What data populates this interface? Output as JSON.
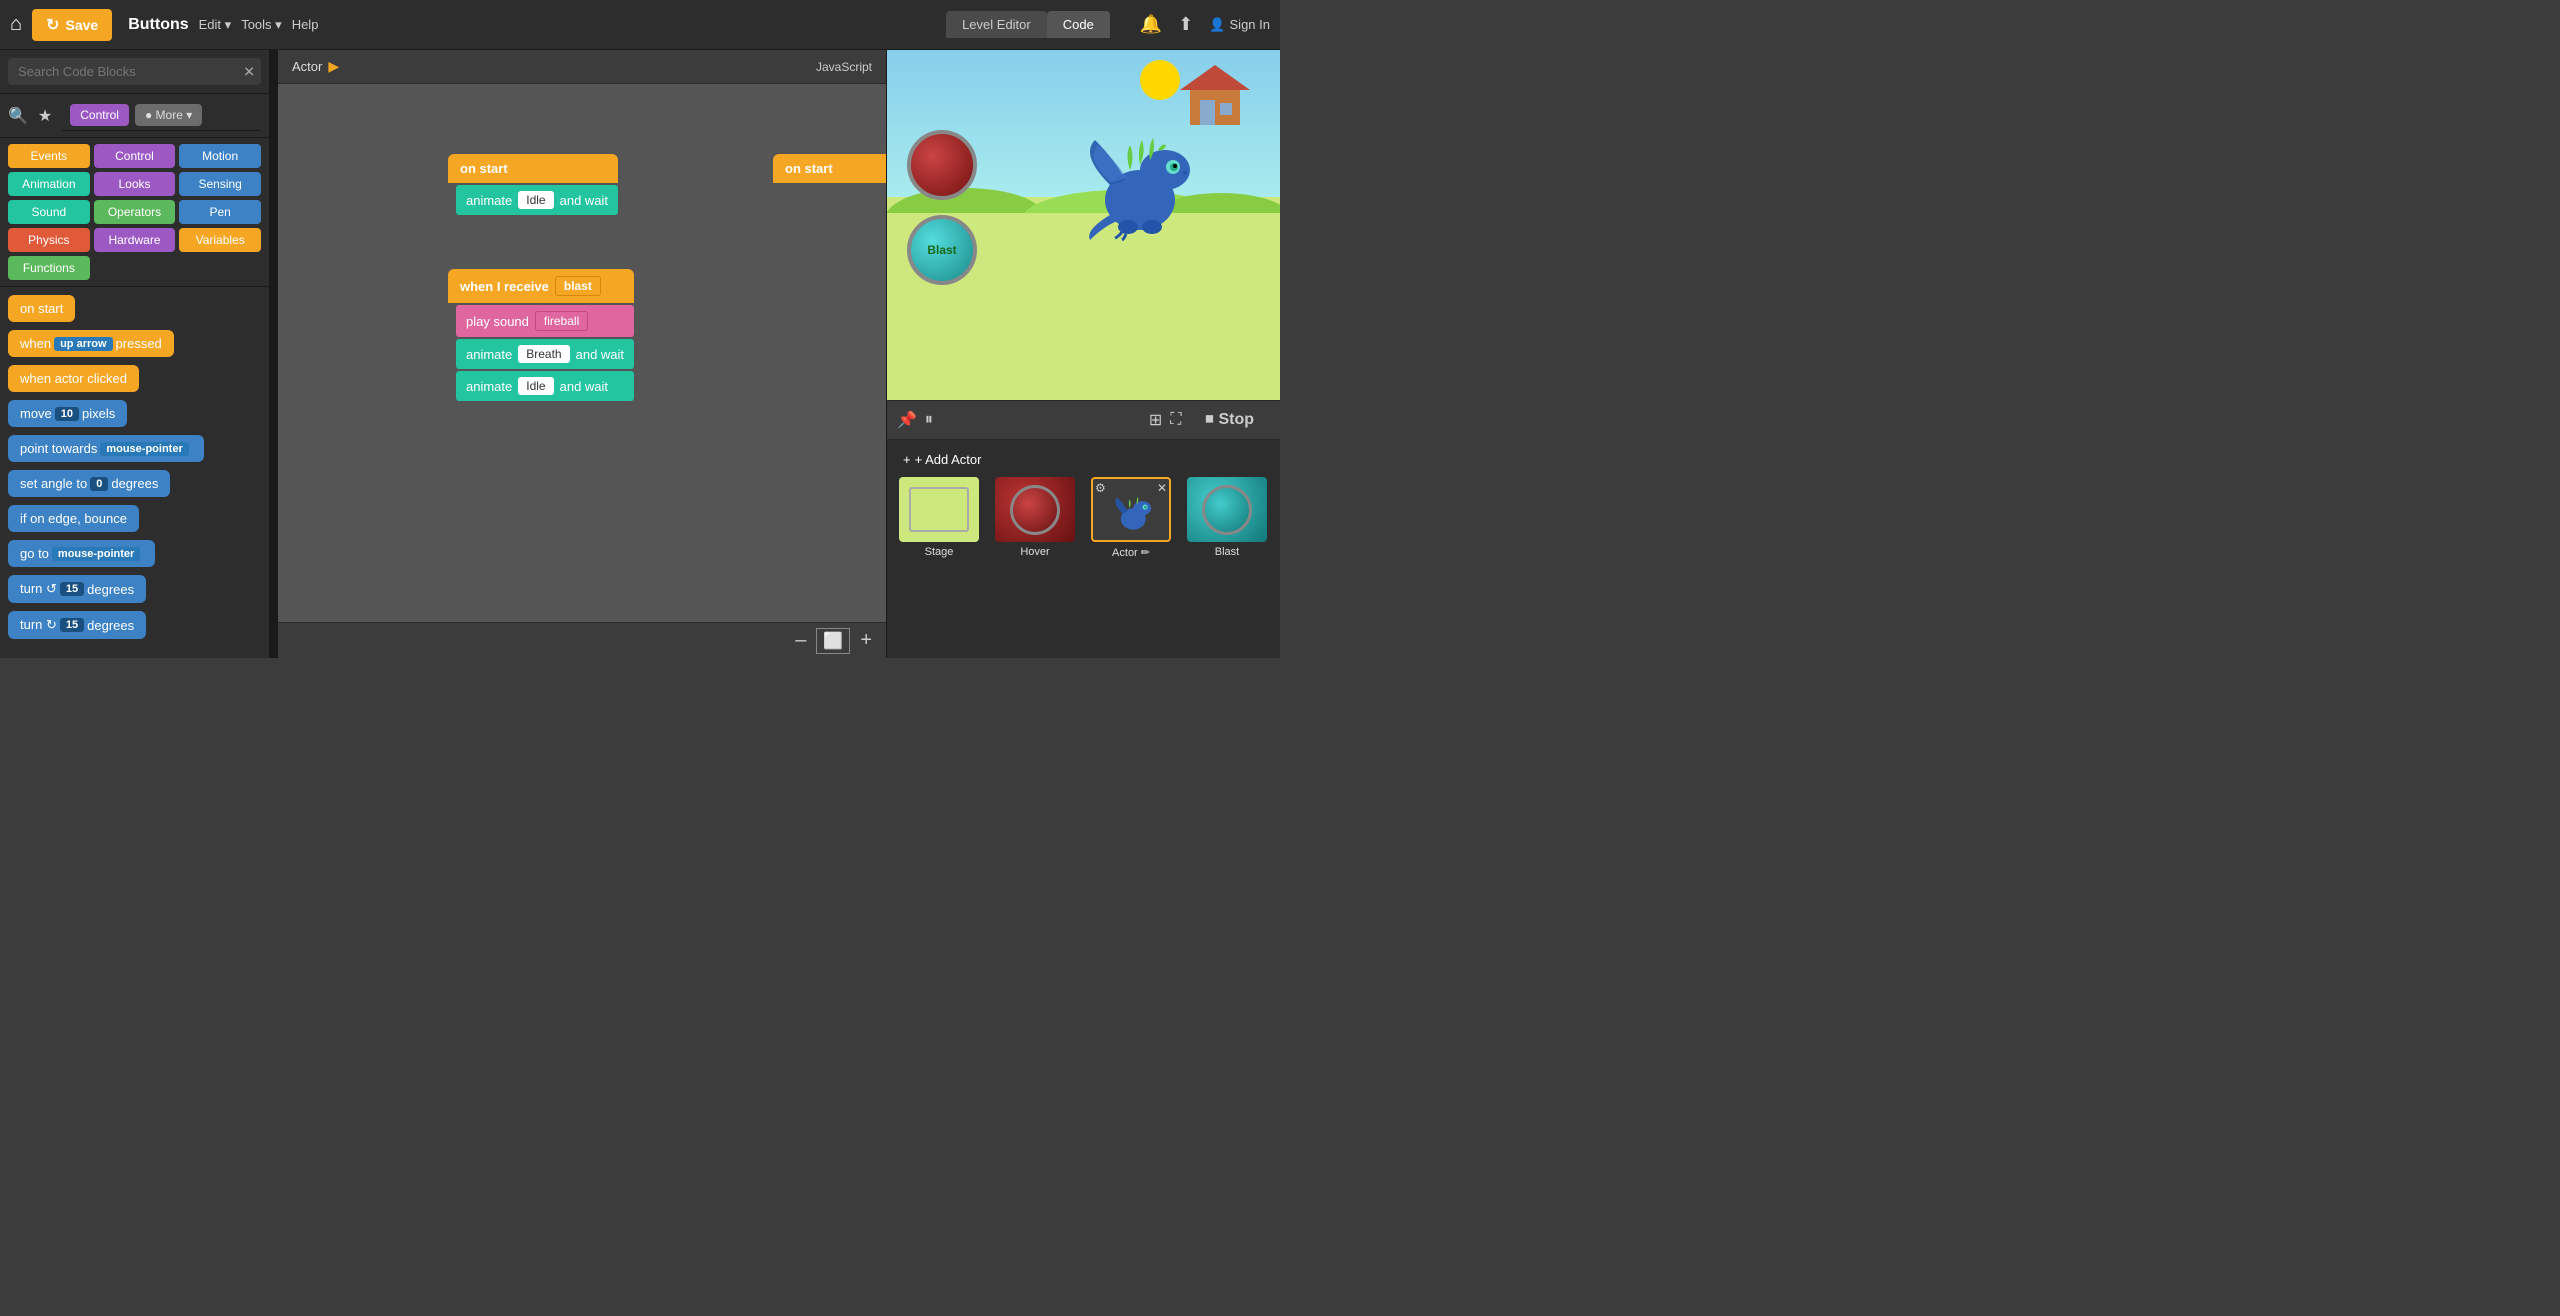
{
  "topbar": {
    "home_label": "⌂",
    "save_label": "Save",
    "app_title": "Buttons",
    "menu": {
      "edit": "Edit ▾",
      "tools": "Tools ▾",
      "help": "Help"
    },
    "tabs": {
      "level_editor": "Level Editor",
      "code": "Code"
    },
    "right": {
      "bell_icon": "🔔",
      "share_icon": "↑",
      "sign_in": "Sign In"
    }
  },
  "left_panel": {
    "search_placeholder": "Search Code Blocks",
    "search_clear": "✕",
    "search_icon": "🔍",
    "star_icon": "★",
    "control_tab": "Control",
    "more_tab": "● More",
    "categories": [
      {
        "label": "Events",
        "class": "cat-events"
      },
      {
        "label": "Control",
        "class": "cat-control"
      },
      {
        "label": "Motion",
        "class": "cat-motion"
      },
      {
        "label": "Animation",
        "class": "cat-animation"
      },
      {
        "label": "Looks",
        "class": "cat-looks"
      },
      {
        "label": "Sensing",
        "class": "cat-sensing"
      },
      {
        "label": "Sound",
        "class": "cat-sound"
      },
      {
        "label": "Operators",
        "class": "cat-operators"
      },
      {
        "label": "Pen",
        "class": "cat-pen"
      },
      {
        "label": "Physics",
        "class": "cat-physics"
      },
      {
        "label": "Hardware",
        "class": "cat-hardware"
      },
      {
        "label": "Variables",
        "class": "cat-variables"
      },
      {
        "label": "Functions",
        "class": "cat-functions"
      }
    ],
    "blocks": [
      {
        "label": "on start",
        "color": "block-orange",
        "parts": []
      },
      {
        "label": "when",
        "color": "block-orange",
        "badge": "up arrow",
        "suffix": "pressed"
      },
      {
        "label": "when actor clicked",
        "color": "block-orange"
      },
      {
        "label": "move",
        "color": "block-blue",
        "badge": "10",
        "suffix": "pixels"
      },
      {
        "label": "point towards",
        "color": "block-blue",
        "badge": "mouse-pointer"
      },
      {
        "label": "set angle to",
        "color": "block-blue",
        "badge": "0",
        "suffix": "degrees"
      },
      {
        "label": "if on edge, bounce",
        "color": "block-blue"
      },
      {
        "label": "go to",
        "color": "block-blue",
        "badge": "mouse-pointer"
      },
      {
        "label": "turn ↺",
        "color": "block-blue",
        "badge": "15",
        "suffix": "degrees"
      },
      {
        "label": "turn ↻",
        "color": "block-blue",
        "badge": "15",
        "suffix": "degrees"
      }
    ]
  },
  "center_panel": {
    "breadcrumb": {
      "actor": "Actor",
      "arrow": "▶"
    },
    "js_btn": "JavaScript",
    "code_groups": [
      {
        "trigger": "on start",
        "blocks": [
          {
            "type": "teal",
            "text": "animate",
            "badge": "Idle",
            "suffix": "and wait"
          }
        ]
      },
      {
        "trigger": "when I receive",
        "trigger_badge": "blast",
        "blocks": [
          {
            "type": "pink",
            "text": "play sound",
            "badge": "fireball"
          },
          {
            "type": "teal",
            "text": "animate",
            "badge": "Breath",
            "suffix": "and wait"
          },
          {
            "type": "teal",
            "text": "animate",
            "badge": "Idle",
            "suffix": "and wait"
          }
        ]
      },
      {
        "trigger": "on start",
        "blocks": []
      }
    ],
    "zoom": {
      "minus": "–",
      "square": "⬜",
      "plus": "+"
    }
  },
  "right_panel": {
    "control_bar": {
      "pin_icon": "📌",
      "pause_icon": "⏸",
      "grid_icon": "⊞",
      "fullscreen_icon": "⛶",
      "stop_label": "Stop",
      "stop_icon": "⏹"
    },
    "add_actor_label": "+ Add Actor",
    "actors": [
      {
        "label": "Stage",
        "type": "stage",
        "icon": "🌿"
      },
      {
        "label": "Hover",
        "type": "hover",
        "icon": "🔴"
      },
      {
        "label": "Actor",
        "type": "actor",
        "icon": "🐉",
        "has_gear": true,
        "has_close": true,
        "editable": true
      },
      {
        "label": "Blast",
        "type": "blast",
        "icon": "🟢"
      }
    ]
  }
}
